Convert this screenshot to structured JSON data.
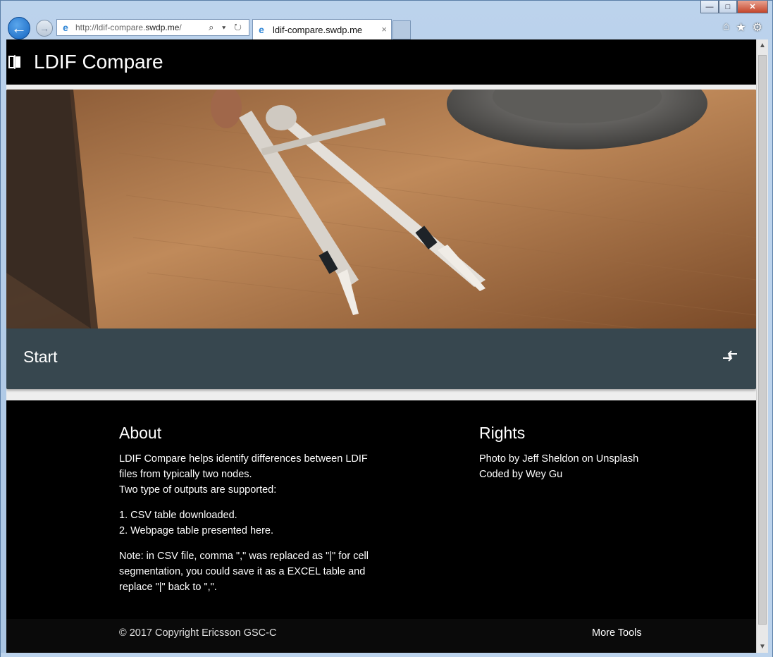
{
  "window": {
    "title": "",
    "buttons": {
      "minimize": "—",
      "maximize": "□",
      "close": "✕"
    }
  },
  "browser": {
    "back_icon": "back-arrow-icon",
    "forward_icon": "forward-arrow-icon",
    "address": {
      "prefix": "http://ldif-compare.",
      "domain": "swdp.me",
      "suffix": "/"
    },
    "address_tools": "⌕ ▾ ↻",
    "tab": {
      "label": "ldif-compare.swdp.me",
      "close": "×"
    },
    "right_tools": {
      "home": "⌂",
      "favorites": "★",
      "settings": "⚙"
    }
  },
  "header": {
    "title": "LDIF Compare",
    "logo_icon": "compare-logo-icon"
  },
  "hero": {
    "image": "drafting-compass-on-wooden-desk-photo"
  },
  "start": {
    "title": "Start",
    "icon": "compare-arrows-icon"
  },
  "about": {
    "heading": "About",
    "intro": "LDIF Compare helps identify differences between LDIF files from typically two nodes.",
    "intro2": "Two type of outputs are supported:",
    "items": [
      "1. CSV table downloaded.",
      "2. Webpage table presented here."
    ],
    "note": "Note: in CSV file, comma \",\" was replaced as \"|\" for cell segmentation, you could save it as a EXCEL table and replace \"|\" back to \",\"."
  },
  "rights": {
    "heading": "Rights",
    "lines": [
      "Photo by Jeff Sheldon on Unsplash",
      "Coded by Wey Gu"
    ]
  },
  "footer": {
    "copyright": "© 2017 Copyright Ericsson GSC-C",
    "more_tools": "More Tools"
  },
  "colors": {
    "header_bg": "#000000",
    "start_bg": "#37474f",
    "footer_bg": "#000000"
  }
}
